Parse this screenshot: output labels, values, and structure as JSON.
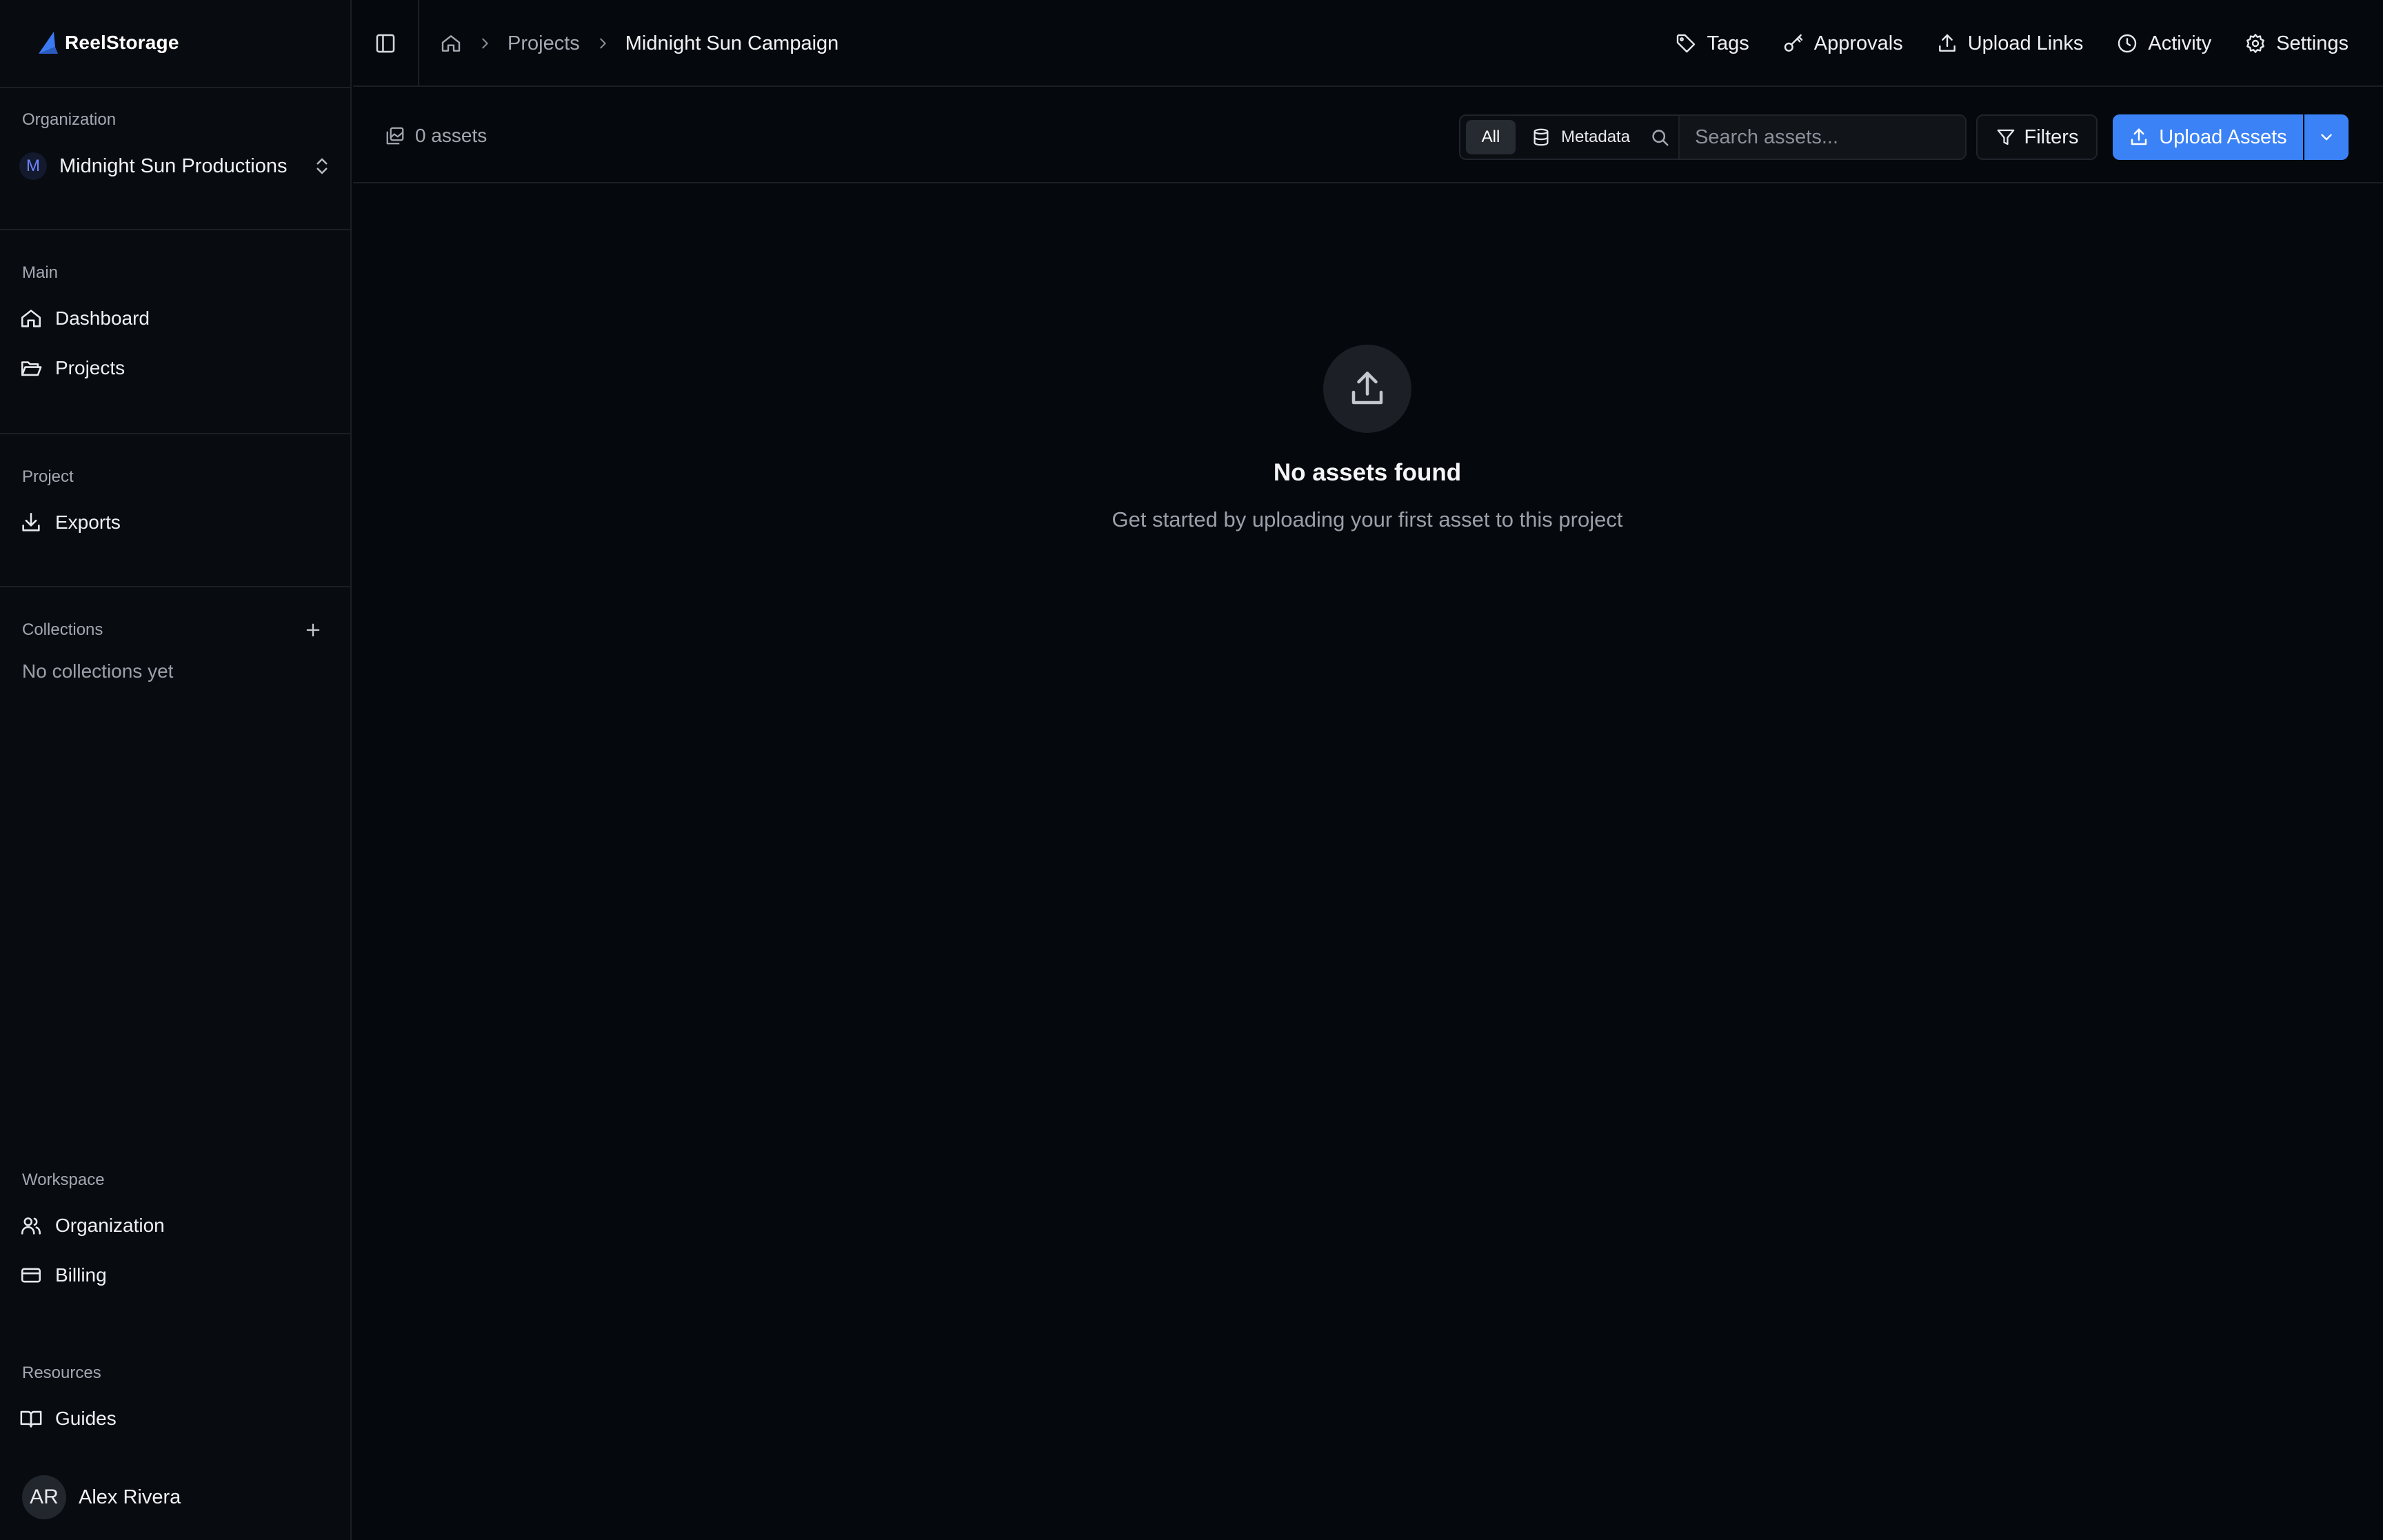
{
  "app": {
    "name": "ReelStorage",
    "accent": "#3b82f6"
  },
  "sidebar": {
    "org_heading": "Organization",
    "org_badge": "M",
    "org_name": "Midnight Sun Productions",
    "main_heading": "Main",
    "main_items": [
      {
        "label": "Dashboard",
        "icon": "home-icon"
      },
      {
        "label": "Projects",
        "icon": "folder-open-icon"
      }
    ],
    "project_heading": "Project",
    "project_items": [
      {
        "label": "Exports",
        "icon": "download-icon"
      }
    ],
    "collections_heading": "Collections",
    "collections_empty": "No collections yet",
    "workspace_heading": "Workspace",
    "workspace_items": [
      {
        "label": "Organization",
        "icon": "users-icon"
      },
      {
        "label": "Billing",
        "icon": "credit-card-icon"
      }
    ],
    "resources_heading": "Resources",
    "resources_items": [
      {
        "label": "Guides",
        "icon": "book-open-icon"
      }
    ],
    "user": {
      "initials": "AR",
      "name": "Alex Rivera"
    }
  },
  "header": {
    "breadcrumb": {
      "projects": "Projects",
      "current": "Midnight Sun Campaign"
    },
    "actions": [
      {
        "label": "Tags",
        "icon": "tag-icon"
      },
      {
        "label": "Approvals",
        "icon": "key-icon"
      },
      {
        "label": "Upload Links",
        "icon": "upload-icon"
      },
      {
        "label": "Activity",
        "icon": "clock-icon"
      },
      {
        "label": "Settings",
        "icon": "gear-icon"
      }
    ]
  },
  "toolbar": {
    "asset_count": "0 assets",
    "all_label": "All",
    "metadata_label": "Metadata",
    "search_placeholder": "Search assets...",
    "filters_label": "Filters",
    "upload_label": "Upload Assets"
  },
  "empty_state": {
    "title": "No assets found",
    "subtitle": "Get started by uploading your first asset to this project"
  }
}
